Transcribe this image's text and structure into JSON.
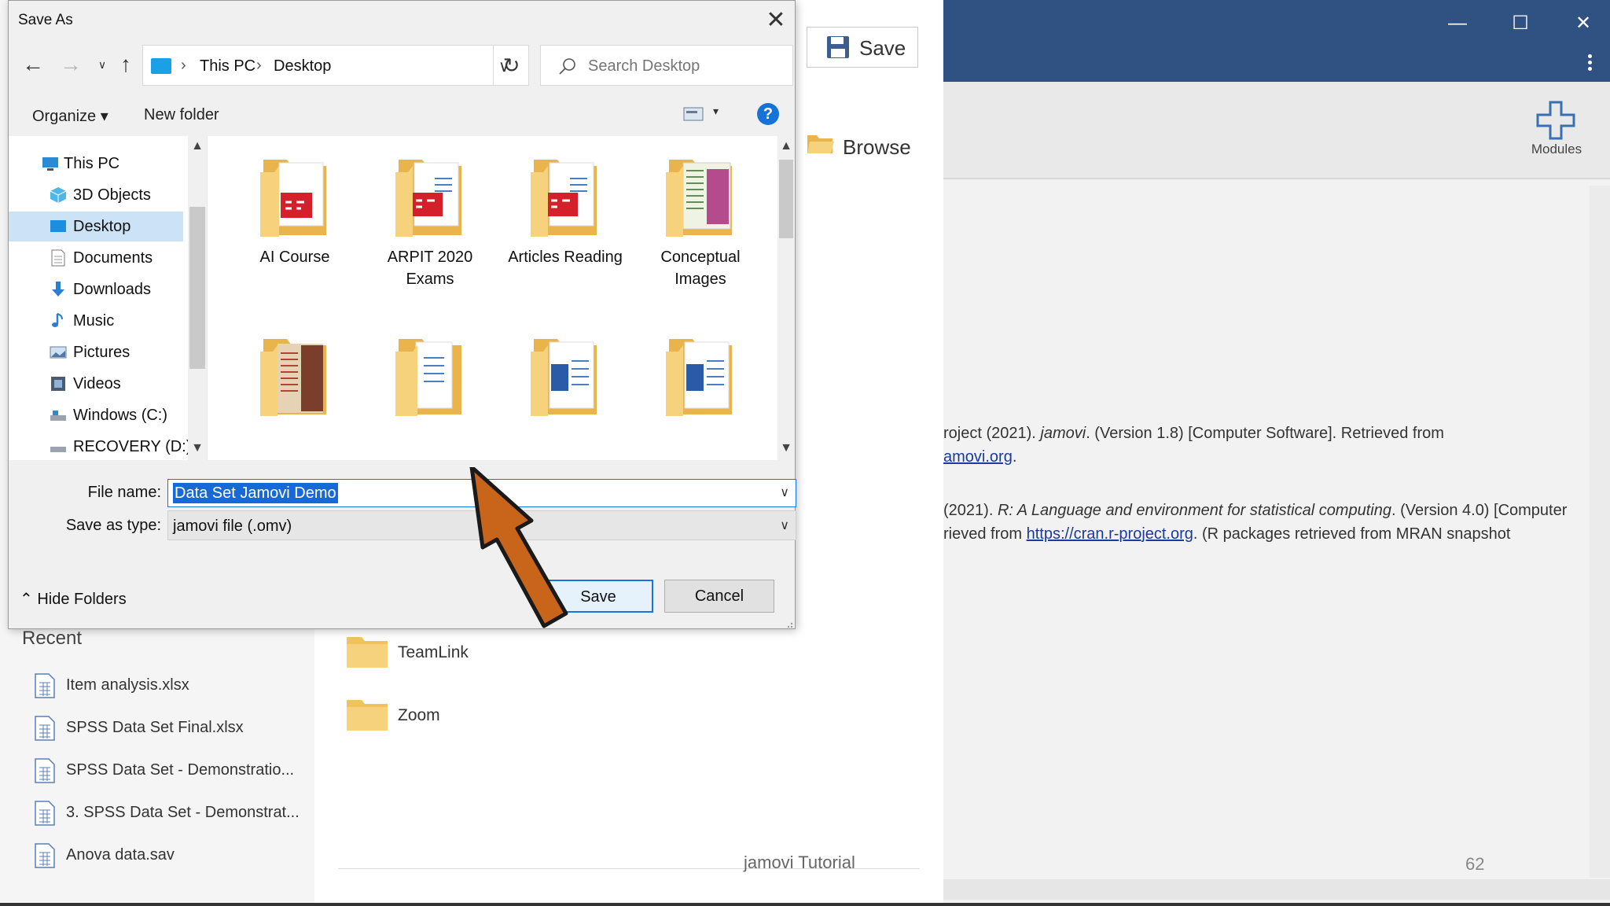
{
  "dialog": {
    "title": "Save As",
    "breadcrumbs": [
      "This PC",
      "Desktop"
    ],
    "search_placeholder": "Search Desktop",
    "toolbar": {
      "organize": "Organize",
      "new_folder": "New folder",
      "help": "?"
    },
    "nav_items": [
      {
        "label": "This PC",
        "icon": "this-pc-icon"
      },
      {
        "label": "3D Objects",
        "icon": "3d-objects-icon"
      },
      {
        "label": "Desktop",
        "icon": "desktop-icon",
        "selected": true
      },
      {
        "label": "Documents",
        "icon": "documents-icon"
      },
      {
        "label": "Downloads",
        "icon": "downloads-icon"
      },
      {
        "label": "Music",
        "icon": "music-icon"
      },
      {
        "label": "Pictures",
        "icon": "pictures-icon"
      },
      {
        "label": "Videos",
        "icon": "videos-icon"
      },
      {
        "label": "Windows (C:)",
        "icon": "drive-icon"
      },
      {
        "label": "RECOVERY (D:)",
        "icon": "drive-icon"
      }
    ],
    "folders": [
      {
        "label": "AI Course",
        "content": "pdf"
      },
      {
        "label": "ARPIT 2020 Exams",
        "content": "pdf"
      },
      {
        "label": "Articles Reading",
        "content": "pdf"
      },
      {
        "label": "Conceptual Images",
        "content": "images"
      },
      {
        "label": "",
        "content": "book"
      },
      {
        "label": "",
        "content": "docs"
      },
      {
        "label": "",
        "content": "word"
      },
      {
        "label": "",
        "content": "word"
      }
    ],
    "file_name_label": "File name:",
    "file_name_value": "Data Set Jamovi Demo",
    "save_type_label": "Save as type:",
    "save_type_value": "jamovi file (.omv)",
    "hide_folders": "Hide Folders",
    "save_button": "Save",
    "cancel_button": "Cancel"
  },
  "jamovi": {
    "backstage_save": "Save",
    "browse": "Browse",
    "recent_title": "Recent",
    "recent_items": [
      "Item analysis.xlsx",
      "SPSS Data Set Final.xlsx",
      "SPSS Data Set - Demonstratio...",
      "3. SPSS Data Set - Demonstrat...",
      "Anova data.sav"
    ],
    "places": [
      "TeamLink",
      "Zoom"
    ],
    "modules_label": "Modules",
    "ref1_a": "roject (2021). ",
    "ref1_b": "jamovi",
    "ref1_c": ". (Version 1.8) [Computer Software]. Retrieved from",
    "ref1_link": "amovi.org",
    "ref2_a": "(2021). ",
    "ref2_b": "R: A Language and environment for statistical computing",
    "ref2_c": ". (Version 4.0) [Computer",
    "ref2_d": "rieved from ",
    "ref2_link": "https://cran.r-project.org",
    "ref2_e": ". (R packages retrieved from MRAN snapshot",
    "footer": "jamovi Tutorial",
    "page_number": "62"
  },
  "colors": {
    "titlebar": "#2f5282",
    "selection": "#1669d6",
    "arrow": "#c8651b",
    "folder": "#f5d27a"
  }
}
